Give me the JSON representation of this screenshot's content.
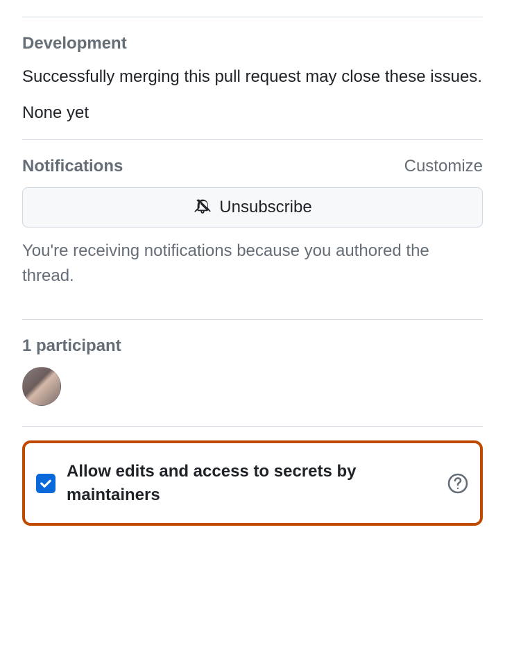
{
  "development": {
    "title": "Development",
    "description": "Successfully merging this pull request may close these issues.",
    "none_yet": "None yet"
  },
  "notifications": {
    "title": "Notifications",
    "customize_label": "Customize",
    "unsubscribe_label": "Unsubscribe",
    "reason": "You're receiving notifications because you authored the thread."
  },
  "participants": {
    "count_label": "1 participant"
  },
  "allow_edits": {
    "checked": true,
    "label": "Allow edits and access to secrets by maintainers"
  }
}
